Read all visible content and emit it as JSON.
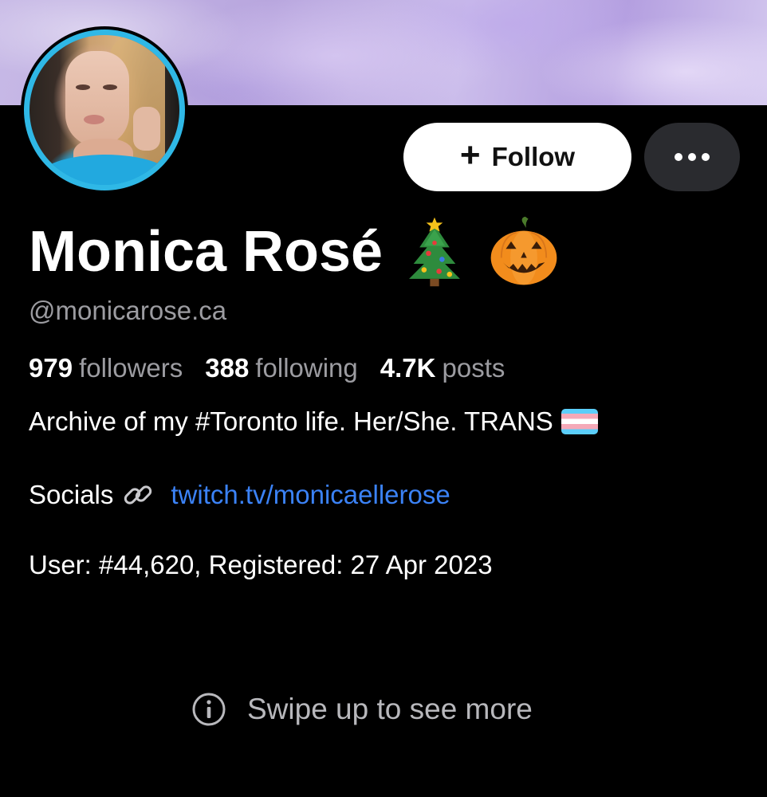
{
  "profile": {
    "display_name": "Monica Rosé",
    "name_emojis": [
      "christmas-tree-icon",
      "jack-o-lantern-icon"
    ],
    "handle": "@monicarose.ca",
    "stats": {
      "followers": {
        "count": "979",
        "label": "followers"
      },
      "following": {
        "count": "388",
        "label": "following"
      },
      "posts": {
        "count": "4.7K",
        "label": "posts"
      }
    },
    "bio": "Archive of my #Toronto life. Her/She. TRANS",
    "bio_flag": "transgender-flag-icon",
    "socials": {
      "label": "Socials",
      "link_icon": "link-icon",
      "link_text": "twitch.tv/monicaellerose"
    },
    "user_info": "User: #44,620, Registered: 27 Apr 2023"
  },
  "actions": {
    "follow_label": "Follow",
    "follow_icon": "plus-icon",
    "more_icon": "more-dots-icon"
  },
  "hint": {
    "icon": "info-icon",
    "text": "Swipe up to see more"
  },
  "colors": {
    "background": "#000000",
    "avatar_ring": "#2fb8e6",
    "link": "#3b82f6",
    "muted_text": "#9c9ca1",
    "more_button_bg": "#2a2b2f"
  }
}
